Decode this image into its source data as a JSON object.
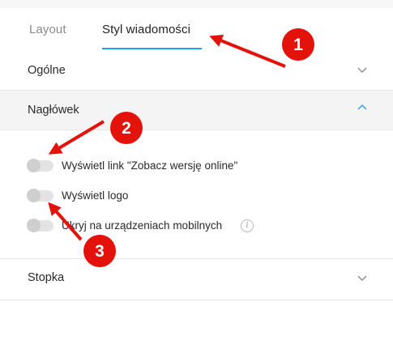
{
  "tabs": [
    {
      "label": "Layout",
      "active": false
    },
    {
      "label": "Styl wiadomości",
      "active": true
    }
  ],
  "sections": {
    "general": {
      "title": "Ogólne",
      "expanded": false
    },
    "header": {
      "title": "Nagłówek",
      "expanded": true,
      "options": [
        {
          "label": "Wyświetl link \"Zobacz wersję online\"",
          "enabled": false
        },
        {
          "label": "Wyświetl logo",
          "enabled": false
        },
        {
          "label": "Ukryj na urządzeniach mobilnych",
          "enabled": false,
          "info_icon": "info-icon"
        }
      ]
    },
    "footer": {
      "title": "Stopka",
      "expanded": false
    }
  },
  "annotations": [
    {
      "number": "1",
      "color": "#e3120b"
    },
    {
      "number": "2",
      "color": "#e3120b"
    },
    {
      "number": "3",
      "color": "#e3120b"
    }
  ],
  "colors": {
    "accent": "#1da1f2",
    "annotation": "#e3120b"
  }
}
